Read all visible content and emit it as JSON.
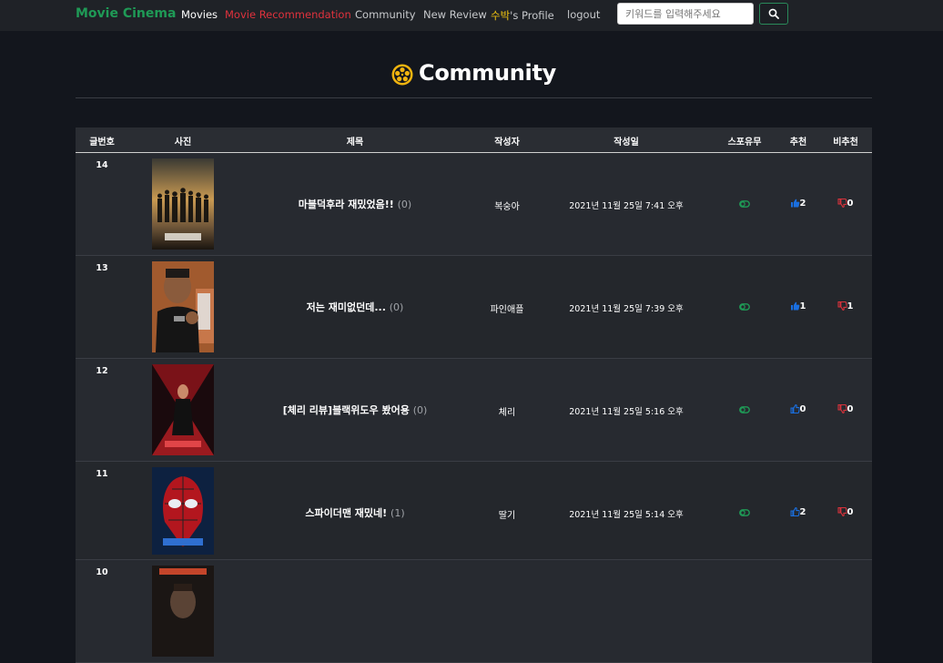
{
  "nav": {
    "brand": "Movie Cinema",
    "movies": "Movies",
    "recommendation": "Movie Recommendation",
    "community": "Community",
    "new_review": "New Review",
    "profile_user": "수박",
    "profile_suffix": "'s Profile",
    "logout": "logout",
    "search_placeholder": "키워드를 입력해주세요"
  },
  "colors": {
    "brand": "#1f9a56",
    "recommendation": "#e0323d",
    "profile_user": "#f1c40f",
    "like": "#1a6fe0",
    "dislike": "#d8323b",
    "spoiler": "#1f9a56"
  },
  "page": {
    "title": "Community"
  },
  "table": {
    "headers": {
      "num": "글번호",
      "photo": "사진",
      "title": "제목",
      "author": "작성자",
      "date": "작성일",
      "spoiler": "스포유무",
      "like": "추천",
      "dislike": "비추천"
    },
    "rows": [
      {
        "num": "14",
        "poster": "eternals",
        "title": "마블덕후라 재밌었음!!",
        "comments": "(0)",
        "author": "복숭아",
        "date": "2021년 11월 25일 7:41 오후",
        "likes": "2",
        "dislikes": "0",
        "liked": true,
        "disliked": false
      },
      {
        "num": "13",
        "poster": "ma-dong-seok",
        "title": "저는 재미없던데...",
        "comments": "(0)",
        "author": "파인애플",
        "date": "2021년 11월 25일 7:39 오후",
        "likes": "1",
        "dislikes": "1",
        "liked": true,
        "disliked": false
      },
      {
        "num": "12",
        "poster": "black-widow",
        "title": "[체리 리뷰]블랙위도우 봤어용",
        "comments": "(0)",
        "author": "체리",
        "date": "2021년 11월 25일 5:16 오후",
        "likes": "0",
        "dislikes": "0",
        "liked": false,
        "disliked": false
      },
      {
        "num": "11",
        "poster": "spider-man",
        "title": "스파이더맨 재밌네!",
        "comments": "(1)",
        "author": "딸기",
        "date": "2021년 11월 25일 5:14 오후",
        "likes": "2",
        "dislikes": "0",
        "liked": false,
        "disliked": false
      },
      {
        "num": "10",
        "poster": "poster-10",
        "title": "",
        "comments": "",
        "author": "",
        "date": "",
        "likes": "",
        "dislikes": "",
        "liked": false,
        "disliked": false
      }
    ]
  }
}
